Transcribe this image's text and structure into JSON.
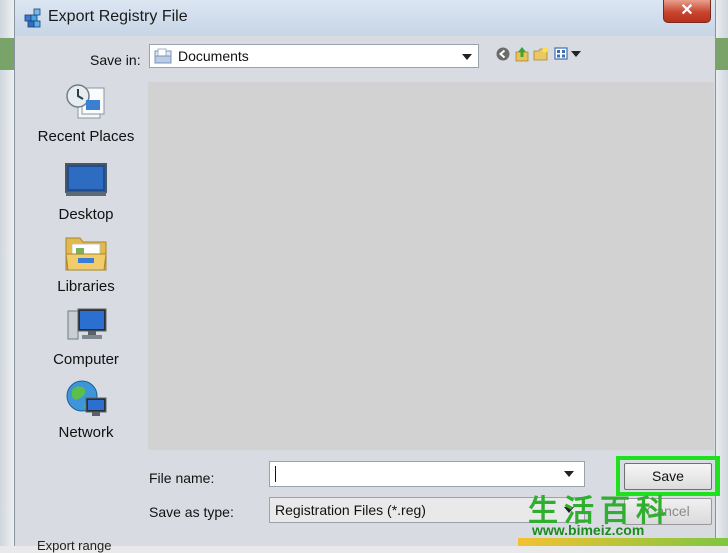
{
  "dialog": {
    "title": "Export Registry File",
    "close_glyph": "✕"
  },
  "save_in": {
    "label": "Save in:",
    "value": "Documents"
  },
  "toolbar": {
    "icons": [
      "back-icon",
      "up-folder-icon",
      "new-folder-icon",
      "view-menu-icon"
    ]
  },
  "places": [
    {
      "label": "Recent Places",
      "icon": "recent-places-icon"
    },
    {
      "label": "Desktop",
      "icon": "desktop-icon"
    },
    {
      "label": "Libraries",
      "icon": "libraries-icon"
    },
    {
      "label": "Computer",
      "icon": "computer-icon"
    },
    {
      "label": "Network",
      "icon": "network-icon"
    }
  ],
  "file_name": {
    "label": "File name:",
    "value": ""
  },
  "save_as_type": {
    "label": "Save as type:",
    "value": "Registration Files (*.reg)"
  },
  "buttons": {
    "save": "Save",
    "cancel": "Cancel"
  },
  "export_range": {
    "label": "Export range"
  },
  "watermark": {
    "cn": "生活百科",
    "url": "www.bimeiz.com"
  },
  "colors": {
    "highlight": "#1ee11e",
    "file_area": "#d2d2d2"
  }
}
